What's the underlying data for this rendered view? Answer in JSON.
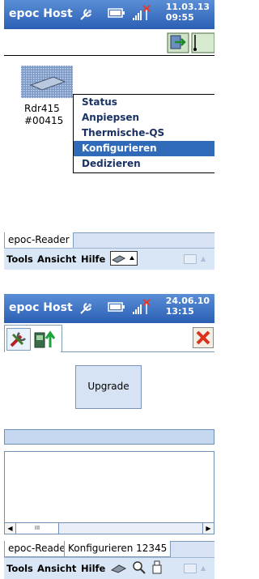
{
  "screen1": {
    "app_title": "epoc Host",
    "clock_date": "11.03.13",
    "clock_time": "09:55",
    "device_label": "Rdr415",
    "device_serial": "#00415",
    "context_menu": [
      "Status",
      "Anpiepsen",
      "Thermische-QS ausführen",
      "Konfigurieren",
      "Dedizieren"
    ],
    "context_menu_selected": "Konfigurieren",
    "tabs": [
      "epoc-Reader"
    ],
    "menu": [
      "Tools",
      "Ansicht",
      "Hilfe"
    ]
  },
  "screen2": {
    "app_title": "epoc Host",
    "clock_date": "24.06.10",
    "clock_time": "13:15",
    "upgrade_button_label": "Upgrade",
    "tabs": [
      "epoc-Reader",
      "Konfigurieren 12345"
    ],
    "menu": [
      "Tools",
      "Ansicht",
      "Hilfe"
    ],
    "scrollbar_glyph": "III"
  },
  "colors": {
    "titlebar": "#2f6bb8",
    "menu_highlight": "#2f6bb8",
    "menubar_bg": "#d9e6f6",
    "close_red": "#d9331f"
  },
  "icons": [
    "settings-icon",
    "battery-icon",
    "signal-icon",
    "exit-icon",
    "reader-device-icon",
    "wrench-icon",
    "upgrade-arrow-icon",
    "close-icon",
    "zoom-icon",
    "keyboard-icon"
  ]
}
